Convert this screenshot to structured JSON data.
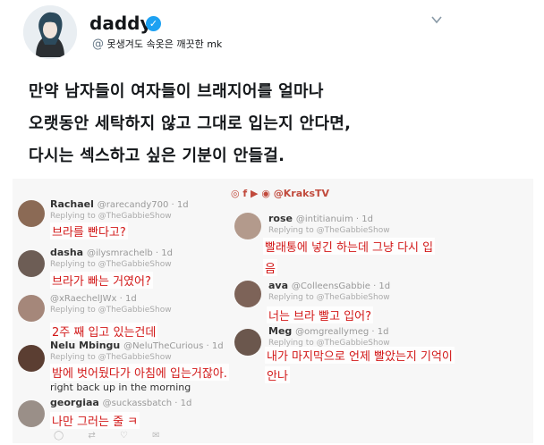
{
  "author": {
    "name": "daddy",
    "handle_prefix": "@",
    "handle": "못생겨도 속옷은 깨끗한 mk"
  },
  "tweet": {
    "lines": [
      "만약 남자들이 여자들이 브래지어를 얼마나",
      "오랫동안 세탁하지 않고 그대로 입는지 안다면,",
      "다시는 섹스하고 싶은 기분이 안들걸."
    ]
  },
  "embedded": {
    "brand": "@KraksTV",
    "left_replies": [
      {
        "name": "Rachael",
        "handle": "@rarecandy700 · 1d",
        "replying": "Replying to @TheGabbieShow",
        "translation": "브라를 빤다고?"
      },
      {
        "name": "dasha",
        "handle": "@ilysmrachelb · 1d",
        "replying": "Replying to @TheGabbieShow",
        "translation": "브라가 빠는 거였어?"
      },
      {
        "name": "",
        "handle": "@xRaechelJWx · 1d",
        "replying": "Replying to @TheGabbieShow",
        "translation": "2주 째 입고 있는건데"
      },
      {
        "name": "Nelu Mbingu",
        "handle": "@NeluTheCurious · 1d",
        "replying": "Replying to @TheGabbieShow",
        "translation": "밤에 벗어뒀다가 아침에 입는거잖아.",
        "original": "right back up in the morning"
      },
      {
        "name": "georgiaa",
        "handle": "@suckassbatch · 1d",
        "replying": "",
        "translation": "나만 그러는 줄 ㅋ"
      }
    ],
    "right_replies": [
      {
        "name": "rose",
        "handle": "@intitianuim · 1d",
        "replying": "Replying to @TheGabbieShow",
        "translation": "빨래통에 넣긴 하는데 그냥 다시 입",
        "translation_cont": "음"
      },
      {
        "name": "ava",
        "handle": "@ColleensGabbie · 1d",
        "replying": "Replying to @TheGabbieShow",
        "translation": "너는 브라 빨고 입어?"
      },
      {
        "name": "Meg",
        "handle": "@omgreallymeg · 1d",
        "replying": "Replying to @TheGabbieShow",
        "translation": "내가 마지막으로 언제 빨았는지 기억이",
        "translation_cont": "안나"
      }
    ]
  },
  "colors": {
    "accent": "#1da1f2",
    "translation": "#d21818",
    "brand": "#c14a3c"
  }
}
